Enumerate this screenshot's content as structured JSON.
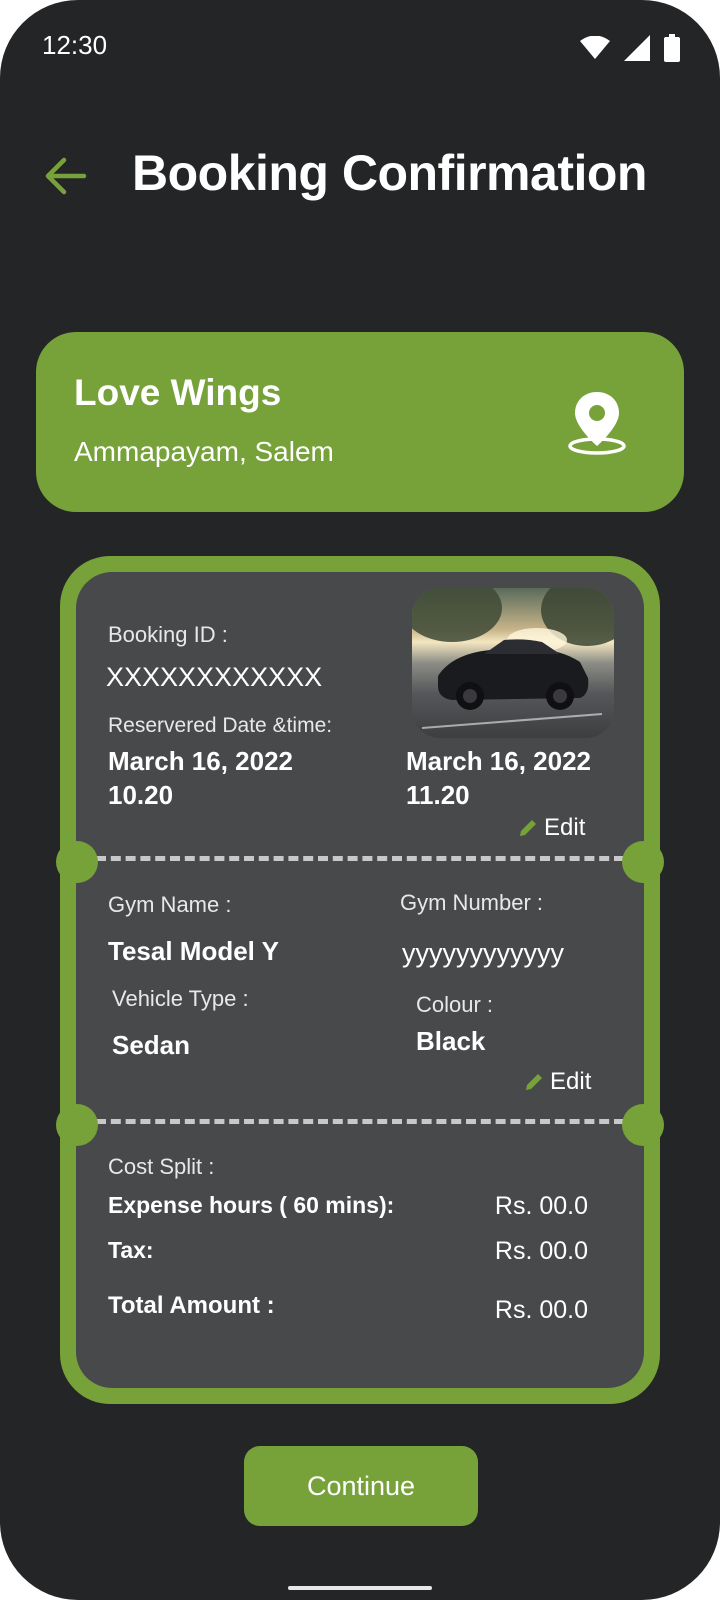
{
  "status_bar": {
    "time": "12:30",
    "icons": [
      "wifi-icon",
      "signal-icon",
      "battery-icon"
    ]
  },
  "header": {
    "back_icon": "arrow-left-icon",
    "title": "Booking Confirmation"
  },
  "venue": {
    "name": "Love Wings",
    "address": "Ammapayam, Salem",
    "icon": "location-pin-icon"
  },
  "booking": {
    "id_label": "Booking ID :",
    "id_value": "XXXXXXXXXXXX",
    "date_label": "Reservered Date &time:",
    "start_date": "March 16, 2022",
    "start_time": "10.20",
    "end_date": "March 16, 2022",
    "end_time": "11.20",
    "edit_label": "Edit"
  },
  "vehicle": {
    "gym_name_label": "Gym Name :",
    "gym_name_value": "Tesal Model Y",
    "gym_number_label": "Gym Number :",
    "gym_number_value": "yyyyyyyyyyyy",
    "vehicle_type_label": "Vehicle Type :",
    "vehicle_type_value": "Sedan",
    "colour_label": "Colour :",
    "colour_value": "Black",
    "edit_label": "Edit"
  },
  "cost": {
    "title": "Cost Split :",
    "rows": [
      {
        "label": "Expense hours ( 60 mins):",
        "value": "Rs. 00.0"
      },
      {
        "label": "Tax:",
        "value": "Rs. 00.0"
      }
    ],
    "total_label": "Total Amount :",
    "total_value": "Rs. 00.0"
  },
  "actions": {
    "continue_label": "Continue"
  },
  "colors": {
    "accent": "#77a23a",
    "background": "#242526",
    "card": "#48494b"
  }
}
